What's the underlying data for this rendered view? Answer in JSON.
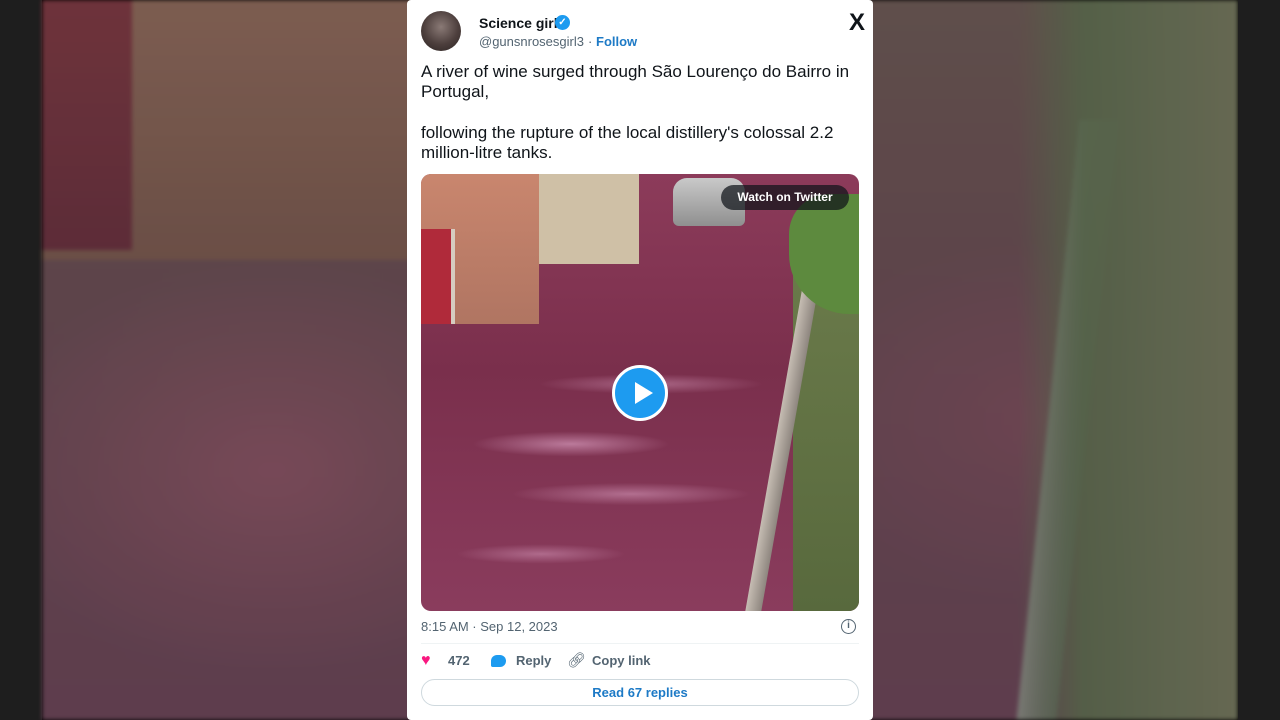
{
  "tweet": {
    "author_name": "Science girl",
    "handle": "@gunsnrosesgirl3",
    "separator": "·",
    "follow_label": "Follow",
    "x_logo": "X",
    "text_line1": "A river of wine surged through São Lourenço do Bairro in Portugal,",
    "text_line2": "following the rupture of the local distillery's colossal 2.2 million-litre tanks.",
    "media": {
      "watch_label": "Watch on Twitter"
    },
    "timestamp": "8:15 AM · Sep 12, 2023",
    "info_icon": "i",
    "actions": {
      "like_count": "472",
      "reply_label": "Reply",
      "copy_label": "Copy link"
    },
    "read_replies_label": "Read 67 replies"
  },
  "colors": {
    "accent": "#1d9bf0",
    "like": "#f91880",
    "link": "#1d7ac6"
  },
  "icons": [
    "verified-badge-icon",
    "x-logo-icon",
    "play-icon",
    "heart-icon",
    "reply-bubble-icon",
    "link-icon",
    "info-icon"
  ]
}
